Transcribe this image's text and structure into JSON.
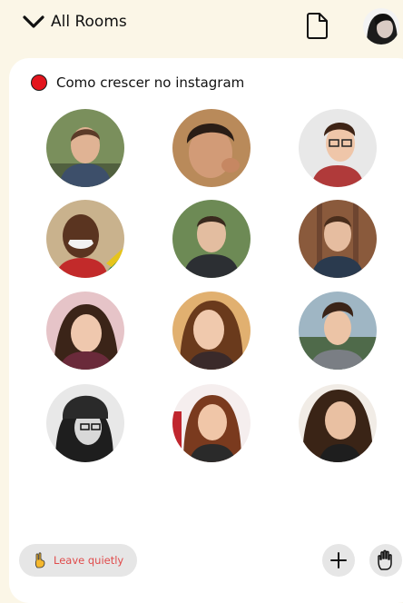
{
  "header": {
    "back_label": "All Rooms",
    "back_icon": "chevron-down-icon",
    "doc_icon": "document-icon",
    "profile_icon": "user-avatar"
  },
  "room": {
    "title": "Como crescer no instagram",
    "status_color": "#e3151d"
  },
  "participants": [
    {
      "icon": "speaker-avatar"
    },
    {
      "icon": "speaker-avatar"
    },
    {
      "icon": "speaker-avatar"
    },
    {
      "icon": "speaker-avatar"
    },
    {
      "icon": "speaker-avatar"
    },
    {
      "icon": "speaker-avatar"
    },
    {
      "icon": "speaker-avatar"
    },
    {
      "icon": "speaker-avatar"
    },
    {
      "icon": "speaker-avatar"
    },
    {
      "icon": "speaker-avatar"
    },
    {
      "icon": "speaker-avatar"
    },
    {
      "icon": "speaker-avatar"
    },
    {
      "icon": "speaker-avatar"
    },
    {
      "icon": "speaker-avatar"
    },
    {
      "icon": "speaker-avatar"
    }
  ],
  "footer": {
    "leave_label": "Leave quietly",
    "leave_icon": "peace-hand-icon",
    "add_icon": "plus-icon",
    "raise_hand_icon": "raise-hand-icon"
  },
  "colors": {
    "background": "#fbf6e7",
    "card": "#ffffff",
    "leave_text": "#e04b4b",
    "button_bg": "#e6e6e6"
  }
}
